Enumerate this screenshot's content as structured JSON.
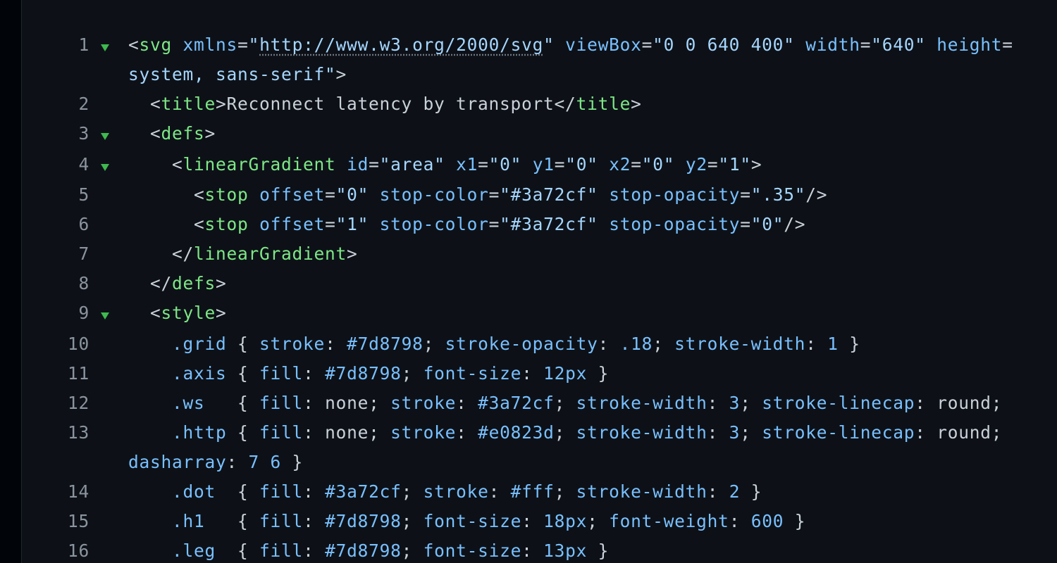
{
  "editor": {
    "lines": [
      {
        "num": "1",
        "fold": true,
        "indent": "",
        "parts": [
          [
            "p",
            "<"
          ],
          [
            "t",
            "svg"
          ],
          [
            "p",
            " "
          ],
          [
            "a",
            "xmlns"
          ],
          [
            "p",
            "="
          ],
          [
            "s",
            "\""
          ],
          [
            "s url",
            "http://www.w3.org/2000/svg"
          ],
          [
            "s",
            "\""
          ],
          [
            "p",
            " "
          ],
          [
            "a",
            "viewBox"
          ],
          [
            "p",
            "="
          ],
          [
            "s",
            "\"0 0 640 400\""
          ],
          [
            "p",
            " "
          ],
          [
            "a",
            "width"
          ],
          [
            "p",
            "="
          ],
          [
            "s",
            "\"640\""
          ],
          [
            "p",
            " "
          ],
          [
            "a",
            "height"
          ],
          [
            "p",
            "="
          ]
        ]
      },
      {
        "num": "",
        "fold": false,
        "indent": "",
        "parts": [
          [
            "s",
            "system, sans-serif\""
          ],
          [
            "p",
            ">"
          ]
        ]
      },
      {
        "num": "2",
        "fold": false,
        "indent": "  ",
        "parts": [
          [
            "p",
            "<"
          ],
          [
            "t",
            "title"
          ],
          [
            "p",
            ">Reconnect latency by transport</"
          ],
          [
            "t",
            "title"
          ],
          [
            "p",
            ">"
          ]
        ]
      },
      {
        "num": "3",
        "fold": true,
        "indent": "  ",
        "parts": [
          [
            "p",
            "<"
          ],
          [
            "t",
            "defs"
          ],
          [
            "p",
            ">"
          ]
        ]
      },
      {
        "num": "4",
        "fold": true,
        "indent": "    ",
        "parts": [
          [
            "p",
            "<"
          ],
          [
            "t",
            "linearGradient"
          ],
          [
            "p",
            " "
          ],
          [
            "a",
            "id"
          ],
          [
            "p",
            "="
          ],
          [
            "s",
            "\"area\""
          ],
          [
            "p",
            " "
          ],
          [
            "a",
            "x1"
          ],
          [
            "p",
            "="
          ],
          [
            "s",
            "\"0\""
          ],
          [
            "p",
            " "
          ],
          [
            "a",
            "y1"
          ],
          [
            "p",
            "="
          ],
          [
            "s",
            "\"0\""
          ],
          [
            "p",
            " "
          ],
          [
            "a",
            "x2"
          ],
          [
            "p",
            "="
          ],
          [
            "s",
            "\"0\""
          ],
          [
            "p",
            " "
          ],
          [
            "a",
            "y2"
          ],
          [
            "p",
            "="
          ],
          [
            "s",
            "\"1\""
          ],
          [
            "p",
            ">"
          ]
        ]
      },
      {
        "num": "5",
        "fold": false,
        "indent": "      ",
        "parts": [
          [
            "p",
            "<"
          ],
          [
            "t",
            "stop"
          ],
          [
            "p",
            " "
          ],
          [
            "a",
            "offset"
          ],
          [
            "p",
            "="
          ],
          [
            "s",
            "\"0\""
          ],
          [
            "p",
            " "
          ],
          [
            "a",
            "stop-color"
          ],
          [
            "p",
            "="
          ],
          [
            "s",
            "\"#3a72cf\""
          ],
          [
            "p",
            " "
          ],
          [
            "a",
            "stop-opacity"
          ],
          [
            "p",
            "="
          ],
          [
            "s",
            "\".35\""
          ],
          [
            "p",
            "/>"
          ]
        ]
      },
      {
        "num": "6",
        "fold": false,
        "indent": "      ",
        "parts": [
          [
            "p",
            "<"
          ],
          [
            "t",
            "stop"
          ],
          [
            "p",
            " "
          ],
          [
            "a",
            "offset"
          ],
          [
            "p",
            "="
          ],
          [
            "s",
            "\"1\""
          ],
          [
            "p",
            " "
          ],
          [
            "a",
            "stop-color"
          ],
          [
            "p",
            "="
          ],
          [
            "s",
            "\"#3a72cf\""
          ],
          [
            "p",
            " "
          ],
          [
            "a",
            "stop-opacity"
          ],
          [
            "p",
            "="
          ],
          [
            "s",
            "\"0\""
          ],
          [
            "p",
            "/>"
          ]
        ]
      },
      {
        "num": "7",
        "fold": false,
        "indent": "    ",
        "parts": [
          [
            "p",
            "</"
          ],
          [
            "t",
            "linearGradient"
          ],
          [
            "p",
            ">"
          ]
        ]
      },
      {
        "num": "8",
        "fold": false,
        "indent": "  ",
        "parts": [
          [
            "p",
            "</"
          ],
          [
            "t",
            "defs"
          ],
          [
            "p",
            ">"
          ]
        ]
      },
      {
        "num": "9",
        "fold": true,
        "indent": "  ",
        "parts": [
          [
            "p",
            "<"
          ],
          [
            "t",
            "style"
          ],
          [
            "p",
            ">"
          ]
        ]
      },
      {
        "num": "10",
        "fold": false,
        "indent": "    ",
        "parts": [
          [
            "c",
            ".grid"
          ],
          [
            "p",
            " { "
          ],
          [
            "a",
            "stroke"
          ],
          [
            "p",
            ": "
          ],
          [
            "v",
            "#7d8798"
          ],
          [
            "p",
            "; "
          ],
          [
            "a",
            "stroke-opacity"
          ],
          [
            "p",
            ": "
          ],
          [
            "v",
            ".18"
          ],
          [
            "p",
            "; "
          ],
          [
            "a",
            "stroke-width"
          ],
          [
            "p",
            ": "
          ],
          [
            "v",
            "1"
          ],
          [
            "p",
            " }"
          ]
        ]
      },
      {
        "num": "11",
        "fold": false,
        "indent": "    ",
        "parts": [
          [
            "c",
            ".axis"
          ],
          [
            "p",
            " { "
          ],
          [
            "a",
            "fill"
          ],
          [
            "p",
            ": "
          ],
          [
            "v",
            "#7d8798"
          ],
          [
            "p",
            "; "
          ],
          [
            "a",
            "font-size"
          ],
          [
            "p",
            ": "
          ],
          [
            "v",
            "12px"
          ],
          [
            "p",
            " }"
          ]
        ]
      },
      {
        "num": "12",
        "fold": false,
        "indent": "    ",
        "parts": [
          [
            "c",
            ".ws"
          ],
          [
            "p",
            "   { "
          ],
          [
            "a",
            "fill"
          ],
          [
            "p",
            ": none; "
          ],
          [
            "a",
            "stroke"
          ],
          [
            "p",
            ": "
          ],
          [
            "v",
            "#3a72cf"
          ],
          [
            "p",
            "; "
          ],
          [
            "a",
            "stroke-width"
          ],
          [
            "p",
            ": "
          ],
          [
            "v",
            "3"
          ],
          [
            "p",
            "; "
          ],
          [
            "a",
            "stroke-linecap"
          ],
          [
            "p",
            ": round;"
          ]
        ]
      },
      {
        "num": "13",
        "fold": false,
        "indent": "    ",
        "parts": [
          [
            "c",
            ".http"
          ],
          [
            "p",
            " { "
          ],
          [
            "a",
            "fill"
          ],
          [
            "p",
            ": none; "
          ],
          [
            "a",
            "stroke"
          ],
          [
            "p",
            ": "
          ],
          [
            "v",
            "#e0823d"
          ],
          [
            "p",
            "; "
          ],
          [
            "a",
            "stroke-width"
          ],
          [
            "p",
            ": "
          ],
          [
            "v",
            "3"
          ],
          [
            "p",
            "; "
          ],
          [
            "a",
            "stroke-linecap"
          ],
          [
            "p",
            ": round;"
          ]
        ]
      },
      {
        "num": "",
        "fold": false,
        "indent": "",
        "parts": [
          [
            "a",
            "dasharray"
          ],
          [
            "p",
            ": "
          ],
          [
            "v",
            "7 6"
          ],
          [
            "p",
            " }"
          ]
        ]
      },
      {
        "num": "14",
        "fold": false,
        "indent": "    ",
        "parts": [
          [
            "c",
            ".dot"
          ],
          [
            "p",
            "  { "
          ],
          [
            "a",
            "fill"
          ],
          [
            "p",
            ": "
          ],
          [
            "v",
            "#3a72cf"
          ],
          [
            "p",
            "; "
          ],
          [
            "a",
            "stroke"
          ],
          [
            "p",
            ": "
          ],
          [
            "v",
            "#fff"
          ],
          [
            "p",
            "; "
          ],
          [
            "a",
            "stroke-width"
          ],
          [
            "p",
            ": "
          ],
          [
            "v",
            "2"
          ],
          [
            "p",
            " }"
          ]
        ]
      },
      {
        "num": "15",
        "fold": false,
        "indent": "    ",
        "parts": [
          [
            "c",
            ".h1"
          ],
          [
            "p",
            "   { "
          ],
          [
            "a",
            "fill"
          ],
          [
            "p",
            ": "
          ],
          [
            "v",
            "#7d8798"
          ],
          [
            "p",
            "; "
          ],
          [
            "a",
            "font-size"
          ],
          [
            "p",
            ": "
          ],
          [
            "v",
            "18px"
          ],
          [
            "p",
            "; "
          ],
          [
            "a",
            "font-weight"
          ],
          [
            "p",
            ": "
          ],
          [
            "v",
            "600"
          ],
          [
            "p",
            " }"
          ]
        ]
      },
      {
        "num": "16",
        "fold": false,
        "indent": "    ",
        "parts": [
          [
            "c",
            ".leg"
          ],
          [
            "p",
            "  { "
          ],
          [
            "a",
            "fill"
          ],
          [
            "p",
            ": "
          ],
          [
            "v",
            "#7d8798"
          ],
          [
            "p",
            "; "
          ],
          [
            "a",
            "font-size"
          ],
          [
            "p",
            ": "
          ],
          [
            "v",
            "13px"
          ],
          [
            "p",
            " }"
          ]
        ]
      }
    ]
  },
  "colors": {
    "background": "#0d1117",
    "gutter_text": "#8b949e",
    "tag": "#7ee787",
    "attribute": "#79c0ff",
    "string": "#a5d6ff",
    "fold_marker": "#3fb950"
  },
  "icons": {
    "fold": "chevron-down-icon"
  }
}
